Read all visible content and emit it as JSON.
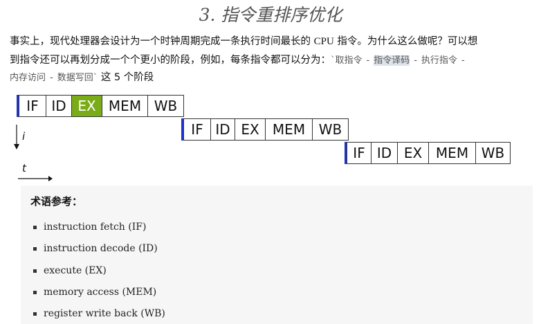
{
  "title": "3. 指令重排序优化",
  "paragraph": {
    "line1_pre": "事实上，现代处理器会设计为一个时钟周期完成一条执行时间最长的 ",
    "line1_cpu": "CPU",
    "line1_post": " 指令。为什么这么做呢？可以想",
    "line2_pre": "到指令还可以再划分成一个个更小的阶段，例如，每条指令都可以分为：",
    "steps": [
      "`取指令",
      "指令译码",
      "执行指令",
      "内存访问",
      "数据写回`"
    ],
    "separator": "-",
    "line3_post": " 这 5 个阶段"
  },
  "pipeline": {
    "stages": [
      "IF",
      "ID",
      "EX",
      "MEM",
      "WB"
    ],
    "highlight_stage": "EX",
    "highlight_color": "#7aac17",
    "row_marker_color": "#1f35c9",
    "y_axis_label": "i",
    "x_axis_label": "t"
  },
  "terms": {
    "heading": "术语参考：",
    "items": [
      "instruction fetch (IF)",
      "instruction decode (ID)",
      "execute (EX)",
      "memory access (MEM)",
      "register write back (WB)"
    ]
  }
}
